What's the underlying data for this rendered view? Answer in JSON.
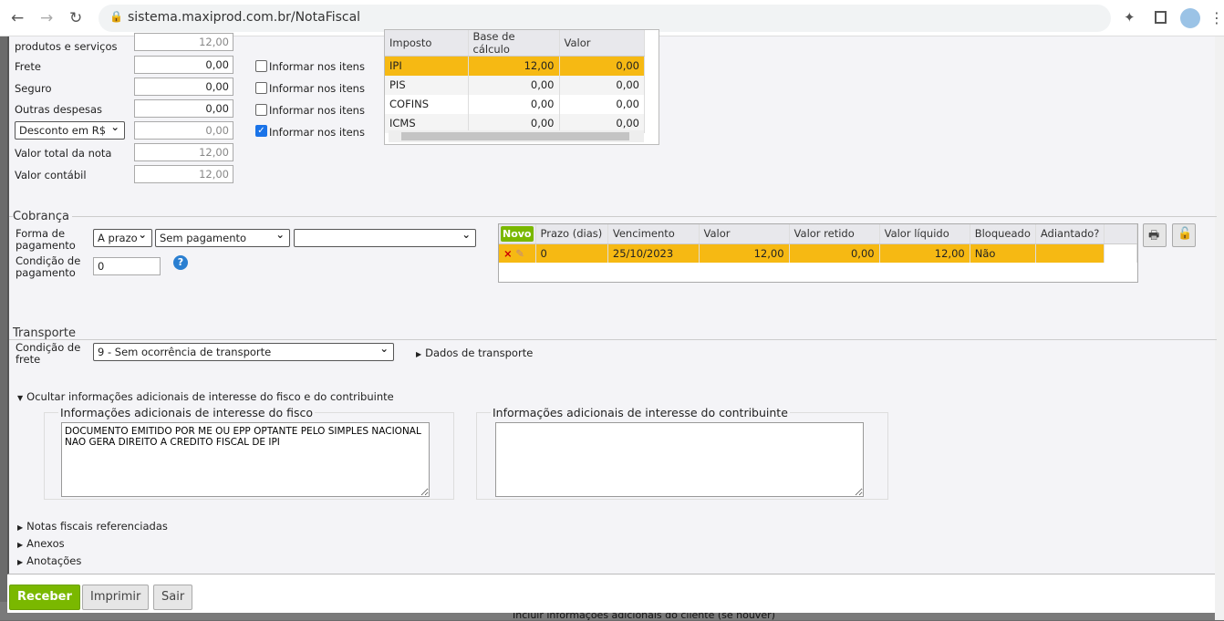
{
  "browser": {
    "url": "sistema.maxiprod.com.br/NotaFiscal",
    "back": "←",
    "forward": "→",
    "reload": "↻"
  },
  "totais": {
    "rows": [
      {
        "label": "produtos e serviços",
        "value": "12,00",
        "disabled": true
      },
      {
        "label": "Frete",
        "value": "0,00",
        "check": "Informar nos itens",
        "checked": false
      },
      {
        "label": "Seguro",
        "value": "0,00",
        "check": "Informar nos itens",
        "checked": false
      },
      {
        "label": "Outras despesas",
        "value": "0,00",
        "check": "Informar nos itens",
        "checked": false
      },
      {
        "label": "Desconto em R$",
        "value": "0,00",
        "check": "Informar nos itens",
        "checked": true,
        "disabled": true
      },
      {
        "label": "Valor total da nota",
        "value": "12,00",
        "disabled": true
      },
      {
        "label": "Valor contábil",
        "value": "12,00",
        "disabled": true
      }
    ]
  },
  "impostos": {
    "headers": [
      "Imposto",
      "Base de cálculo",
      "Valor"
    ],
    "rows": [
      [
        "IPI",
        "12,00",
        "0,00"
      ],
      [
        "PIS",
        "0,00",
        "0,00"
      ],
      [
        "COFINS",
        "0,00",
        "0,00"
      ],
      [
        "ICMS",
        "0,00",
        "0,00"
      ]
    ]
  },
  "cobranca": {
    "title": "Cobrança",
    "forma_label": "Forma de pagamento",
    "forma1": "A prazo",
    "forma2": "Sem pagamento",
    "forma3": "",
    "condicao_label": "Condição de pagamento",
    "condicao": "0",
    "novo": "Novo",
    "headers": [
      "Prazo (dias)",
      "Vencimento",
      "Valor",
      "Valor retido",
      "Valor líquido",
      "Bloqueado",
      "Adiantado?"
    ],
    "rows": [
      [
        "0",
        "25/10/2023",
        "12,00",
        "0,00",
        "12,00",
        "Não",
        ""
      ]
    ]
  },
  "transporte": {
    "title": "Transporte",
    "frete_label": "Condição de frete",
    "frete": "9 - Sem ocorrência de transporte",
    "dados": "Dados de transporte"
  },
  "info": {
    "toggle": "Ocultar informações adicionais de interesse do fisco e do contribuinte",
    "fisco_title": "Informações adicionais de interesse do fisco",
    "fisco_text": "DOCUMENTO EMITIDO POR ME OU EPP OPTANTE PELO SIMPLES NACIONAL NAO GERA DIREITO A CREDITO FISCAL DE IPI",
    "contrib_title": "Informações adicionais de interesse do contribuinte",
    "contrib_text": ""
  },
  "links": [
    "Notas fiscais referenciadas",
    "Anexos",
    "Anotações"
  ],
  "buttons": {
    "receber": "Receber",
    "imprimir": "Imprimir",
    "sair": "Sair"
  },
  "background_text": "Incluir informações adicionais do cliente (se houver)",
  "colors": {
    "accent": "#7ab800",
    "selected": "#f6b913"
  }
}
